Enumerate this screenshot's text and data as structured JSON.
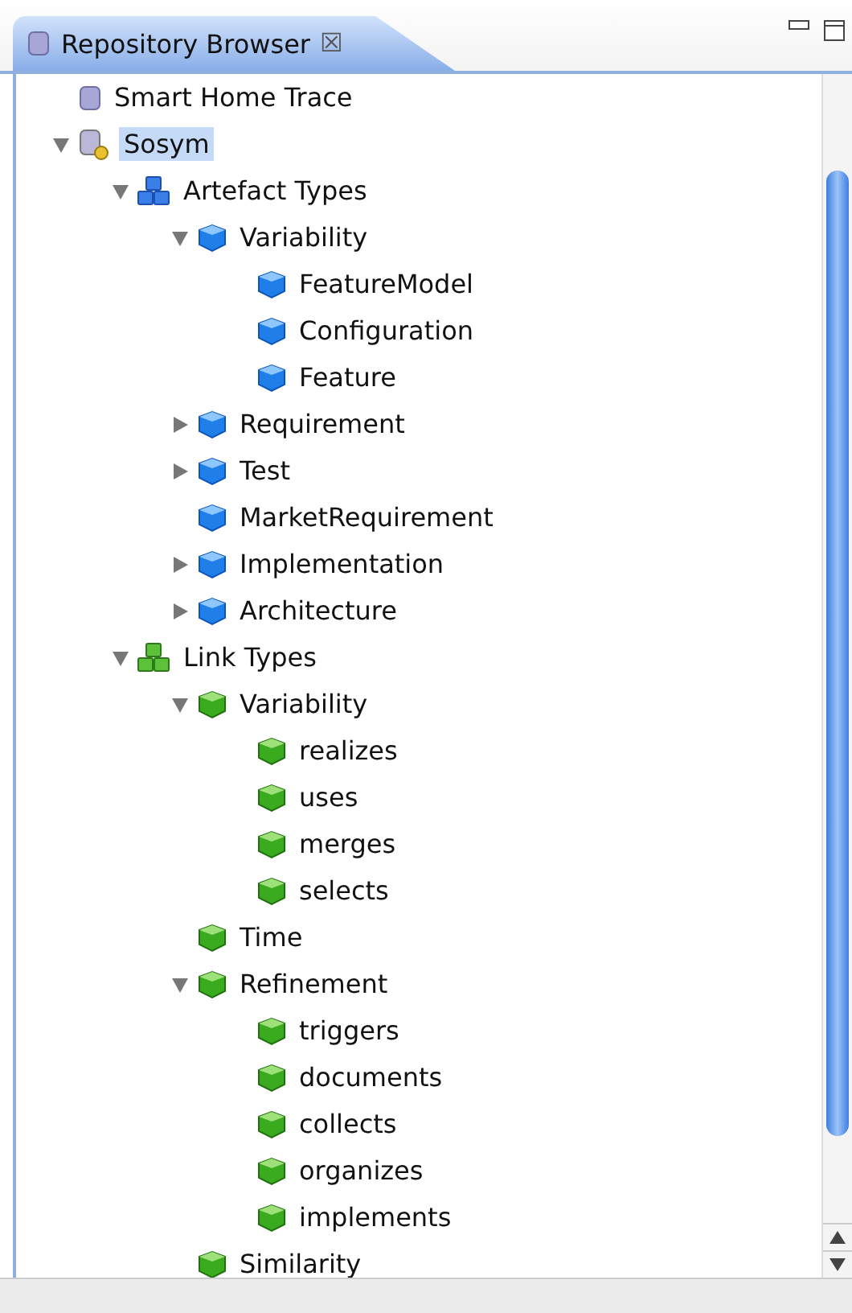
{
  "view": {
    "title": "Repository Browser",
    "close_glyph": "☒"
  },
  "tree": [
    {
      "label": "Smart Home Trace",
      "kind": "repository",
      "selected": false
    },
    {
      "label": "Sosym",
      "kind": "repository-open",
      "selected": true,
      "expanded": true,
      "children": [
        {
          "label": "Artefact Types",
          "kind": "blue-group",
          "selected": false,
          "expanded": true,
          "children": [
            {
              "label": "Variability",
              "kind": "blue-type",
              "selected": false,
              "expanded": true,
              "children": [
                {
                  "label": "FeatureModel",
                  "kind": "blue-type",
                  "selected": false
                },
                {
                  "label": "Configuration",
                  "kind": "blue-type",
                  "selected": false
                },
                {
                  "label": "Feature",
                  "kind": "blue-type",
                  "selected": false
                }
              ]
            },
            {
              "label": "Requirement",
              "kind": "blue-type",
              "selected": false,
              "expanded": false
            },
            {
              "label": "Test",
              "kind": "blue-type",
              "selected": false,
              "expanded": false
            },
            {
              "label": "MarketRequirement",
              "kind": "blue-type",
              "selected": false
            },
            {
              "label": "Implementation",
              "kind": "blue-type",
              "selected": false,
              "expanded": false
            },
            {
              "label": "Architecture",
              "kind": "blue-type",
              "selected": false,
              "expanded": false
            }
          ]
        },
        {
          "label": "Link Types",
          "kind": "green-group",
          "selected": false,
          "expanded": true,
          "children": [
            {
              "label": "Variability",
              "kind": "green-type",
              "selected": false,
              "expanded": true,
              "children": [
                {
                  "label": "realizes",
                  "kind": "green-type",
                  "selected": false
                },
                {
                  "label": "uses",
                  "kind": "green-type",
                  "selected": false
                },
                {
                  "label": "merges",
                  "kind": "green-type",
                  "selected": false
                },
                {
                  "label": "selects",
                  "kind": "green-type",
                  "selected": false
                }
              ]
            },
            {
              "label": "Time",
              "kind": "green-type",
              "selected": false
            },
            {
              "label": "Refinement",
              "kind": "green-type",
              "selected": false,
              "expanded": true,
              "children": [
                {
                  "label": "triggers",
                  "kind": "green-type",
                  "selected": false
                },
                {
                  "label": "documents",
                  "kind": "green-type",
                  "selected": false
                },
                {
                  "label": "collects",
                  "kind": "green-type",
                  "selected": false
                },
                {
                  "label": "organizes",
                  "kind": "green-type",
                  "selected": false
                },
                {
                  "label": "implements",
                  "kind": "green-type",
                  "selected": false
                }
              ]
            },
            {
              "label": "Similarity",
              "kind": "green-type",
              "selected": false
            }
          ]
        }
      ]
    }
  ]
}
